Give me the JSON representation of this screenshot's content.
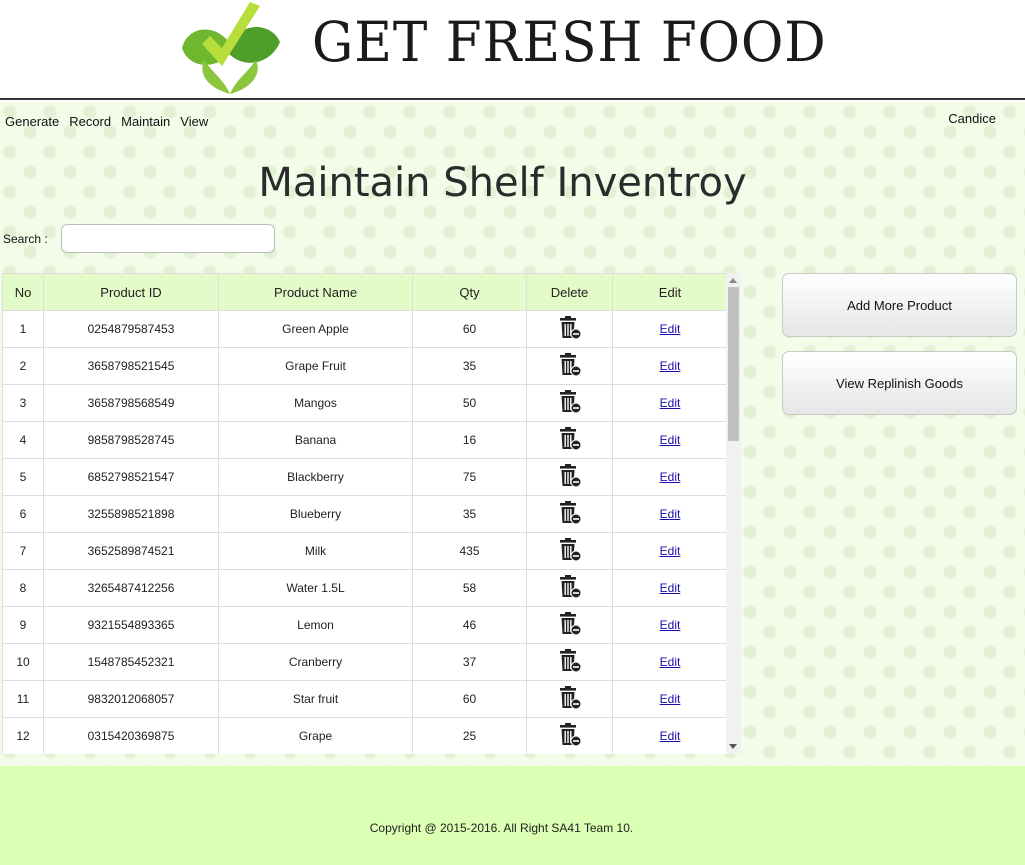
{
  "brand": {
    "title": "GET FRESH FOOD",
    "logo_icon": "leaf-check-icon"
  },
  "nav": {
    "items": [
      "Generate",
      "Record",
      "Maintain",
      "View"
    ],
    "user": "Candice"
  },
  "page": {
    "title": "Maintain Shelf Inventroy"
  },
  "search": {
    "label": "Search :",
    "value": ""
  },
  "table": {
    "headers": [
      "No",
      "Product ID",
      "Product Name",
      "Qty",
      "Delete",
      "Edit"
    ],
    "edit_label": "Edit",
    "delete_icon": "trash-icon",
    "rows": [
      {
        "no": "1",
        "id": "0254879587453",
        "name": "Green Apple",
        "qty": "60"
      },
      {
        "no": "2",
        "id": "3658798521545",
        "name": "Grape Fruit",
        "qty": "35"
      },
      {
        "no": "3",
        "id": "3658798568549",
        "name": "Mangos",
        "qty": "50"
      },
      {
        "no": "4",
        "id": "9858798528745",
        "name": "Banana",
        "qty": "16"
      },
      {
        "no": "5",
        "id": "6852798521547",
        "name": "Blackberry",
        "qty": "75"
      },
      {
        "no": "6",
        "id": "3255898521898",
        "name": "Blueberry",
        "qty": "35"
      },
      {
        "no": "7",
        "id": "3652589874521",
        "name": "Milk",
        "qty": "435"
      },
      {
        "no": "8",
        "id": "3265487412256",
        "name": "Water 1.5L",
        "qty": "58"
      },
      {
        "no": "9",
        "id": "9321554893365",
        "name": "Lemon",
        "qty": "46"
      },
      {
        "no": "10",
        "id": "1548785452321",
        "name": "Cranberry",
        "qty": "37"
      },
      {
        "no": "11",
        "id": "9832012068057",
        "name": "Star fruit",
        "qty": "60"
      },
      {
        "no": "12",
        "id": "0315420369875",
        "name": "Grape",
        "qty": "25"
      }
    ]
  },
  "actions": {
    "add_more": "Add More Product",
    "view_replinish": "View Replinish Goods"
  },
  "footer": {
    "copyright": "Copyright @ 2015-2016. All Right SA41 Team 10."
  },
  "colors": {
    "header_row": "#e2fbc8",
    "footer_bg": "#dbffb3",
    "link": "#1a0dab",
    "logo_green_light": "#a8d64a",
    "logo_green_dark": "#3f9a2b"
  }
}
